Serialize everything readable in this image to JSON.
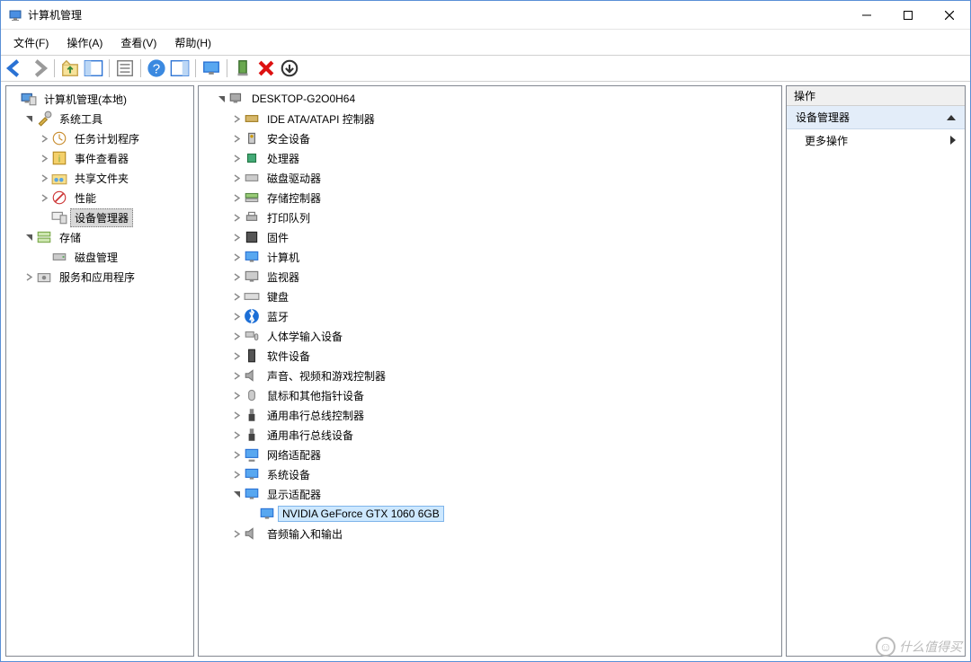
{
  "title": "计算机管理",
  "menu": {
    "file": "文件(F)",
    "action": "操作(A)",
    "view": "查看(V)",
    "help": "帮助(H)"
  },
  "left_tree": {
    "root": "计算机管理(本地)",
    "sys_tools": "系统工具",
    "task_sched": "任务计划程序",
    "event_viewer": "事件查看器",
    "shared": "共享文件夹",
    "perf": "性能",
    "devmgr": "设备管理器",
    "storage": "存储",
    "diskmgmt": "磁盘管理",
    "services": "服务和应用程序"
  },
  "center_tree": {
    "computer": "DESKTOP-G2O0H64",
    "ide": "IDE ATA/ATAPI 控制器",
    "sec": "安全设备",
    "cpu": "处理器",
    "diskdrv": "磁盘驱动器",
    "storctrl": "存储控制器",
    "printq": "打印队列",
    "firmware": "固件",
    "computer_cat": "计算机",
    "monitor": "监视器",
    "keyboard": "键盘",
    "bt": "蓝牙",
    "hid": "人体学输入设备",
    "softdev": "软件设备",
    "avg": "声音、视频和游戏控制器",
    "mouse": "鼠标和其他指针设备",
    "usbctrl": "通用串行总线控制器",
    "usbdev": "通用串行总线设备",
    "net": "网络适配器",
    "sysdev": "系统设备",
    "display": "显示适配器",
    "gpu": "NVIDIA GeForce GTX 1060 6GB",
    "audio": "音频输入和输出"
  },
  "actions": {
    "title": "操作",
    "group": "设备管理器",
    "more": "更多操作"
  },
  "watermark": "什么值得买"
}
